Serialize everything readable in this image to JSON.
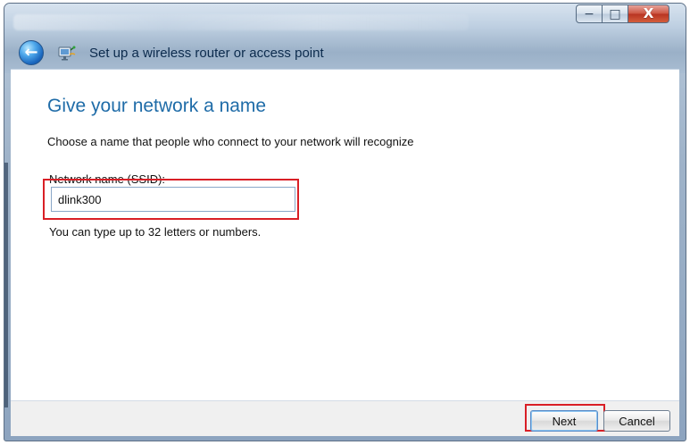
{
  "window": {
    "title": "Set up a wireless router or access point",
    "controls": {
      "minimize_symbol": "−",
      "maximize_symbol": "□",
      "close_symbol": "X"
    }
  },
  "header": {
    "back_icon": "←"
  },
  "main": {
    "heading": "Give your network a name",
    "description": "Choose a name that people who connect to your network will recognize",
    "field_label": "Network name (SSID):",
    "ssid_value": "dlink300",
    "helper_text": "You can type up to 32 letters or numbers."
  },
  "footer": {
    "next_label": "Next",
    "cancel_label": "Cancel"
  },
  "icons": {
    "back": "back-arrow-icon",
    "wizard": "network-setup-icon",
    "minimize": "minimize-icon",
    "maximize": "maximize-icon",
    "close": "close-icon"
  },
  "colors": {
    "heading_blue": "#1f6ca8",
    "highlight_red": "#d91f26",
    "window_blue": "#9fb3c9"
  }
}
